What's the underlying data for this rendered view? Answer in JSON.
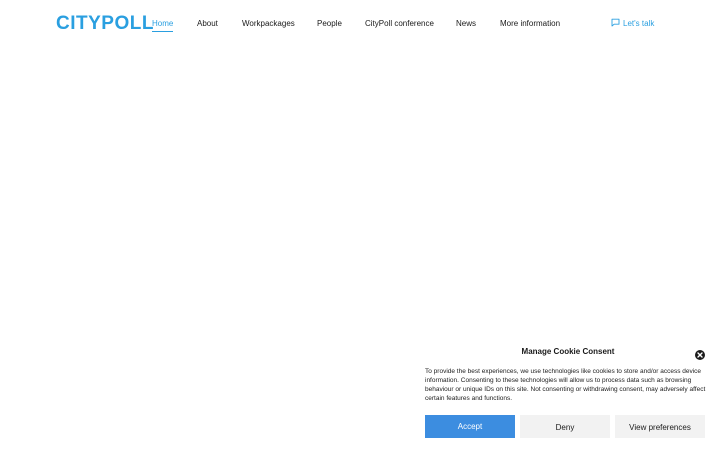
{
  "header": {
    "logo": "CITYPOLL",
    "nav": [
      {
        "label": "Home",
        "active": true
      },
      {
        "label": "About",
        "active": false
      },
      {
        "label": "Workpackages",
        "active": false
      },
      {
        "label": "People",
        "active": false
      },
      {
        "label": "CityPoll conference",
        "active": false
      },
      {
        "label": "News",
        "active": false
      },
      {
        "label": "More information",
        "active": false
      }
    ],
    "cta": {
      "label": "Let's talk",
      "icon": "chat-bubble-icon"
    }
  },
  "cookie": {
    "title": "Manage Cookie Consent",
    "text": "To provide the best experiences, we use technologies like cookies to store and/or access device information. Consenting to these technologies will allow us to process data such as browsing behaviour or unique IDs on this site. Not consenting or withdrawing consent, may adversely affect certain features and functions.",
    "accept": "Accept",
    "deny": "Deny",
    "preferences": "View preferences"
  },
  "colors": {
    "brand": "#2a9fe0",
    "accept_button": "#3c8de0",
    "secondary_button": "#f2f2f2"
  }
}
